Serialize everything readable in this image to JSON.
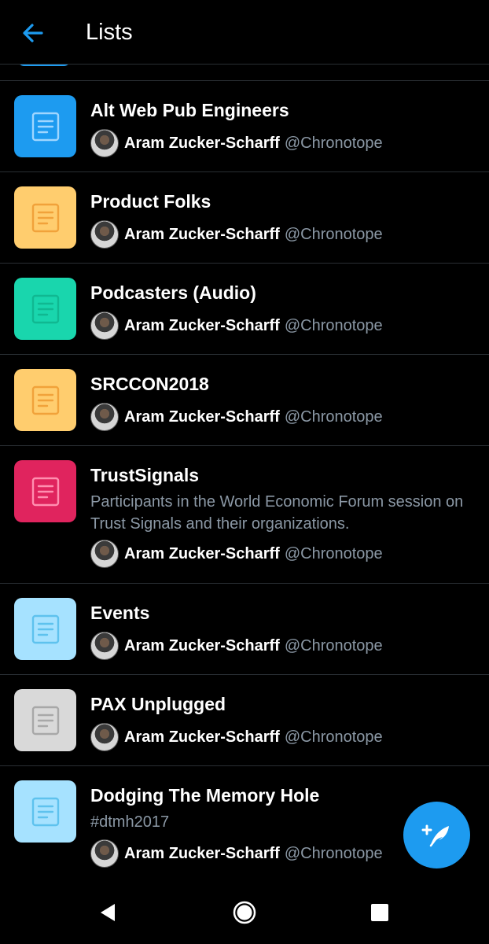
{
  "header": {
    "title": "Lists"
  },
  "colors": {
    "accent": "#1d9bf0",
    "background": "#000000",
    "muted_text": "#8b98a5",
    "divider": "#2a2f34"
  },
  "lists": [
    {
      "name": "Alt Web Pub Engineers",
      "icon_bg": "#1d9bf0",
      "icon_fg": "#9fd6ff",
      "owner": {
        "name": "Aram Zucker-Scharff",
        "handle": "@Chronotope"
      }
    },
    {
      "name": "Product Folks",
      "icon_bg": "#ffcd6e",
      "icon_fg": "#f1a23a",
      "owner": {
        "name": "Aram Zucker-Scharff",
        "handle": "@Chronotope"
      }
    },
    {
      "name": "Podcasters (Audio)",
      "icon_bg": "#19d6ad",
      "icon_fg": "#10b891",
      "owner": {
        "name": "Aram Zucker-Scharff",
        "handle": "@Chronotope"
      }
    },
    {
      "name": "SRCCON2018",
      "icon_bg": "#ffcd6e",
      "icon_fg": "#f1a23a",
      "owner": {
        "name": "Aram Zucker-Scharff",
        "handle": "@Chronotope"
      }
    },
    {
      "name": "TrustSignals",
      "description": "Participants in the World Economic Forum session on Trust Signals and their organizations.",
      "icon_bg": "#e0245e",
      "icon_fg": "#ff8fb0",
      "owner": {
        "name": "Aram Zucker-Scharff",
        "handle": "@Chronotope"
      }
    },
    {
      "name": "Events",
      "icon_bg": "#a6e2ff",
      "icon_fg": "#5ec2ee",
      "owner": {
        "name": "Aram Zucker-Scharff",
        "handle": "@Chronotope"
      }
    },
    {
      "name": "PAX Unplugged",
      "icon_bg": "#d9d9d9",
      "icon_fg": "#a8a8a8",
      "owner": {
        "name": "Aram Zucker-Scharff",
        "handle": "@Chronotope"
      }
    },
    {
      "name": "Dodging The Memory Hole",
      "description": "#dtmh2017",
      "icon_bg": "#a6e2ff",
      "icon_fg": "#5ec2ee",
      "owner": {
        "name": "Aram Zucker-Scharff",
        "handle": "@Chronotope"
      }
    }
  ],
  "icons": {
    "back": "arrow-left-icon",
    "list": "list-document-icon",
    "fab": "compose-tweet-icon",
    "nav_back": "triangle-back-icon",
    "nav_home": "circle-home-icon",
    "nav_recents": "square-recents-icon"
  }
}
